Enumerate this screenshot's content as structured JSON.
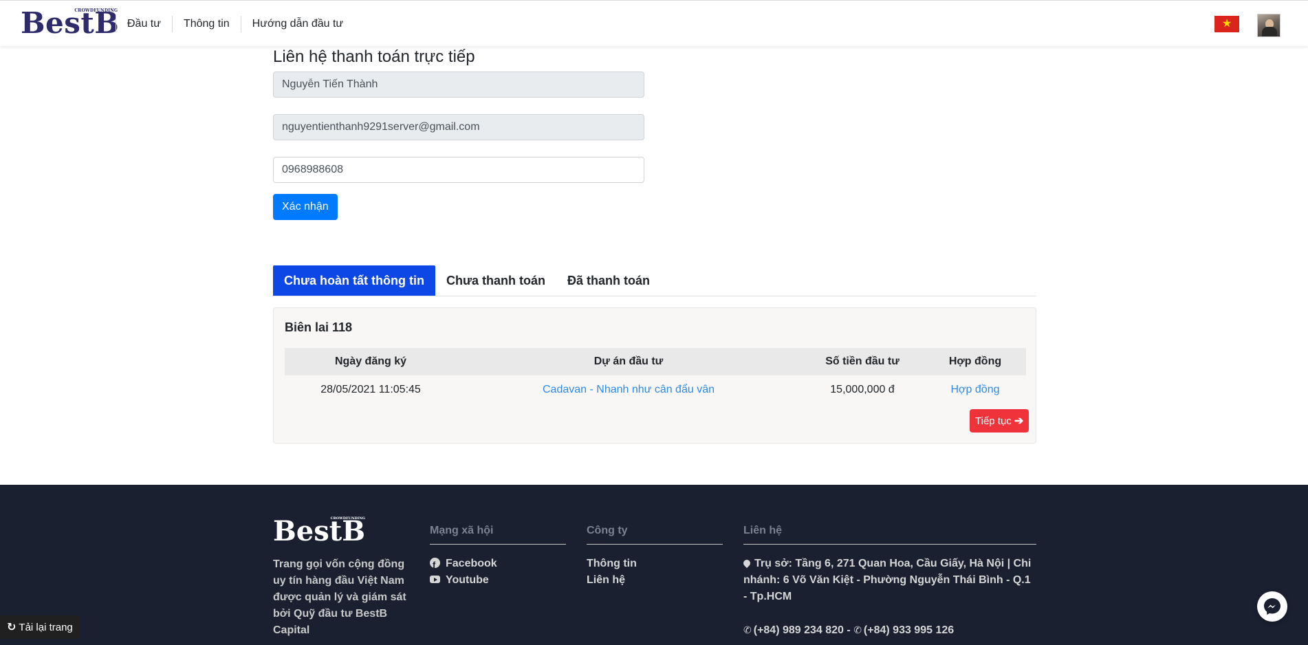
{
  "brand": {
    "name": "BestB",
    "tagline": "CROWDFUNDING"
  },
  "nav": {
    "items": [
      "Đầu tư",
      "Thông tin",
      "Hướng dẫn đầu tư"
    ]
  },
  "form": {
    "title": "Liên hệ thanh toán trực tiếp",
    "name_value": "Nguyễn Tiến Thành",
    "email_value": "nguyentienthanh9291server@gmail.com",
    "phone_value": "0968988608",
    "confirm_label": "Xác nhận"
  },
  "tabs": [
    {
      "label": "Chưa hoàn tất thông tin",
      "active": true
    },
    {
      "label": "Chưa thanh toán",
      "active": false
    },
    {
      "label": "Đã thanh toán",
      "active": false
    }
  ],
  "receipt": {
    "title": "Biên lai 118",
    "columns": [
      "Ngày đăng ký",
      "Dự án đầu tư",
      "Số tiền đầu tư",
      "Hợp đồng"
    ],
    "rows": [
      {
        "date": "28/05/2021 11:05:45",
        "project": "Cadavan - Nhanh như cân đẩu vân",
        "amount": "15,000,000 đ",
        "contract": "Hợp đồng"
      }
    ],
    "next_label": "Tiếp tục"
  },
  "footer": {
    "description": "Trang gọi vốn cộng đồng uy tín hàng đầu Việt Nam được quản lý và giám sát bởi Quỹ đầu tư BestB Capital",
    "social": {
      "heading": "Mạng xã hội",
      "items": [
        "Facebook",
        "Youtube"
      ]
    },
    "company": {
      "heading": "Công ty",
      "items": [
        "Thông tin",
        "Liên hệ"
      ]
    },
    "contact": {
      "heading": "Liên hệ",
      "address": "Trụ sở: Tầng 6, 271 Quan Hoa, Cầu Giấy, Hà Nội | Chi nhánh: 6 Võ Văn Kiệt - Phường Nguyễn Thái Bình - Q.1 - Tp.HCM",
      "phone1": "(+84) 989 234 820 -",
      "phone2": "(+84) 933 995 126"
    }
  },
  "reload_label": "Tải lại trang",
  "colors": {
    "primary": "#007bff",
    "tab_active": "#0d47e6",
    "danger": "#f0323a",
    "footer_bg": "#1a2030",
    "brand": "#2d2b6b"
  }
}
